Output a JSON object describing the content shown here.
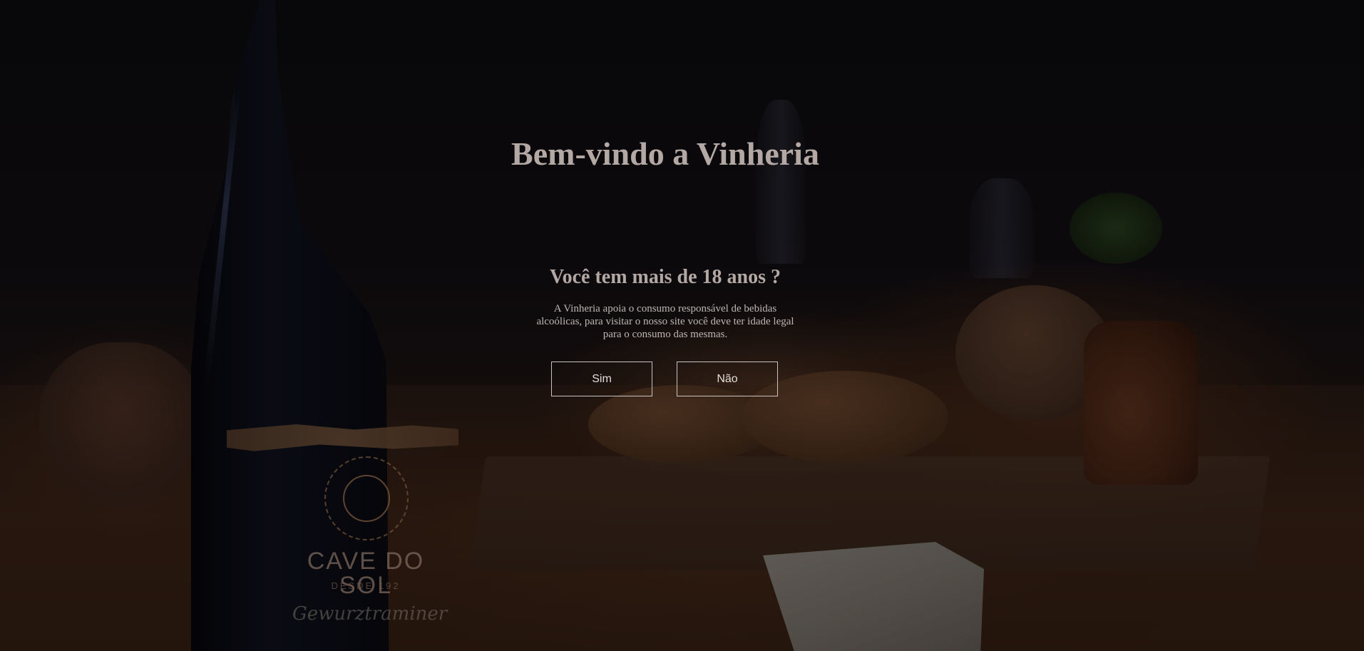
{
  "age_gate": {
    "title": "Bem-vindo a Vinheria",
    "question": "Você tem mais de 18 anos ?",
    "message": "A Vinheria apoia o consumo responsável de bebidas alcoólicas, para visitar o nosso site você deve ter idade legal para o consumo das mesmas.",
    "yes_label": "Sim",
    "no_label": "Não"
  },
  "background": {
    "bottle_brand": "CAVE DO SOL",
    "bottle_since": "DESDE 192",
    "bottle_variety": "Gewurztraminer"
  },
  "colors": {
    "text": "#b3a8a4",
    "button_border": "#c9c3c1",
    "overlay": "rgba(0,0,0,0.38)"
  }
}
